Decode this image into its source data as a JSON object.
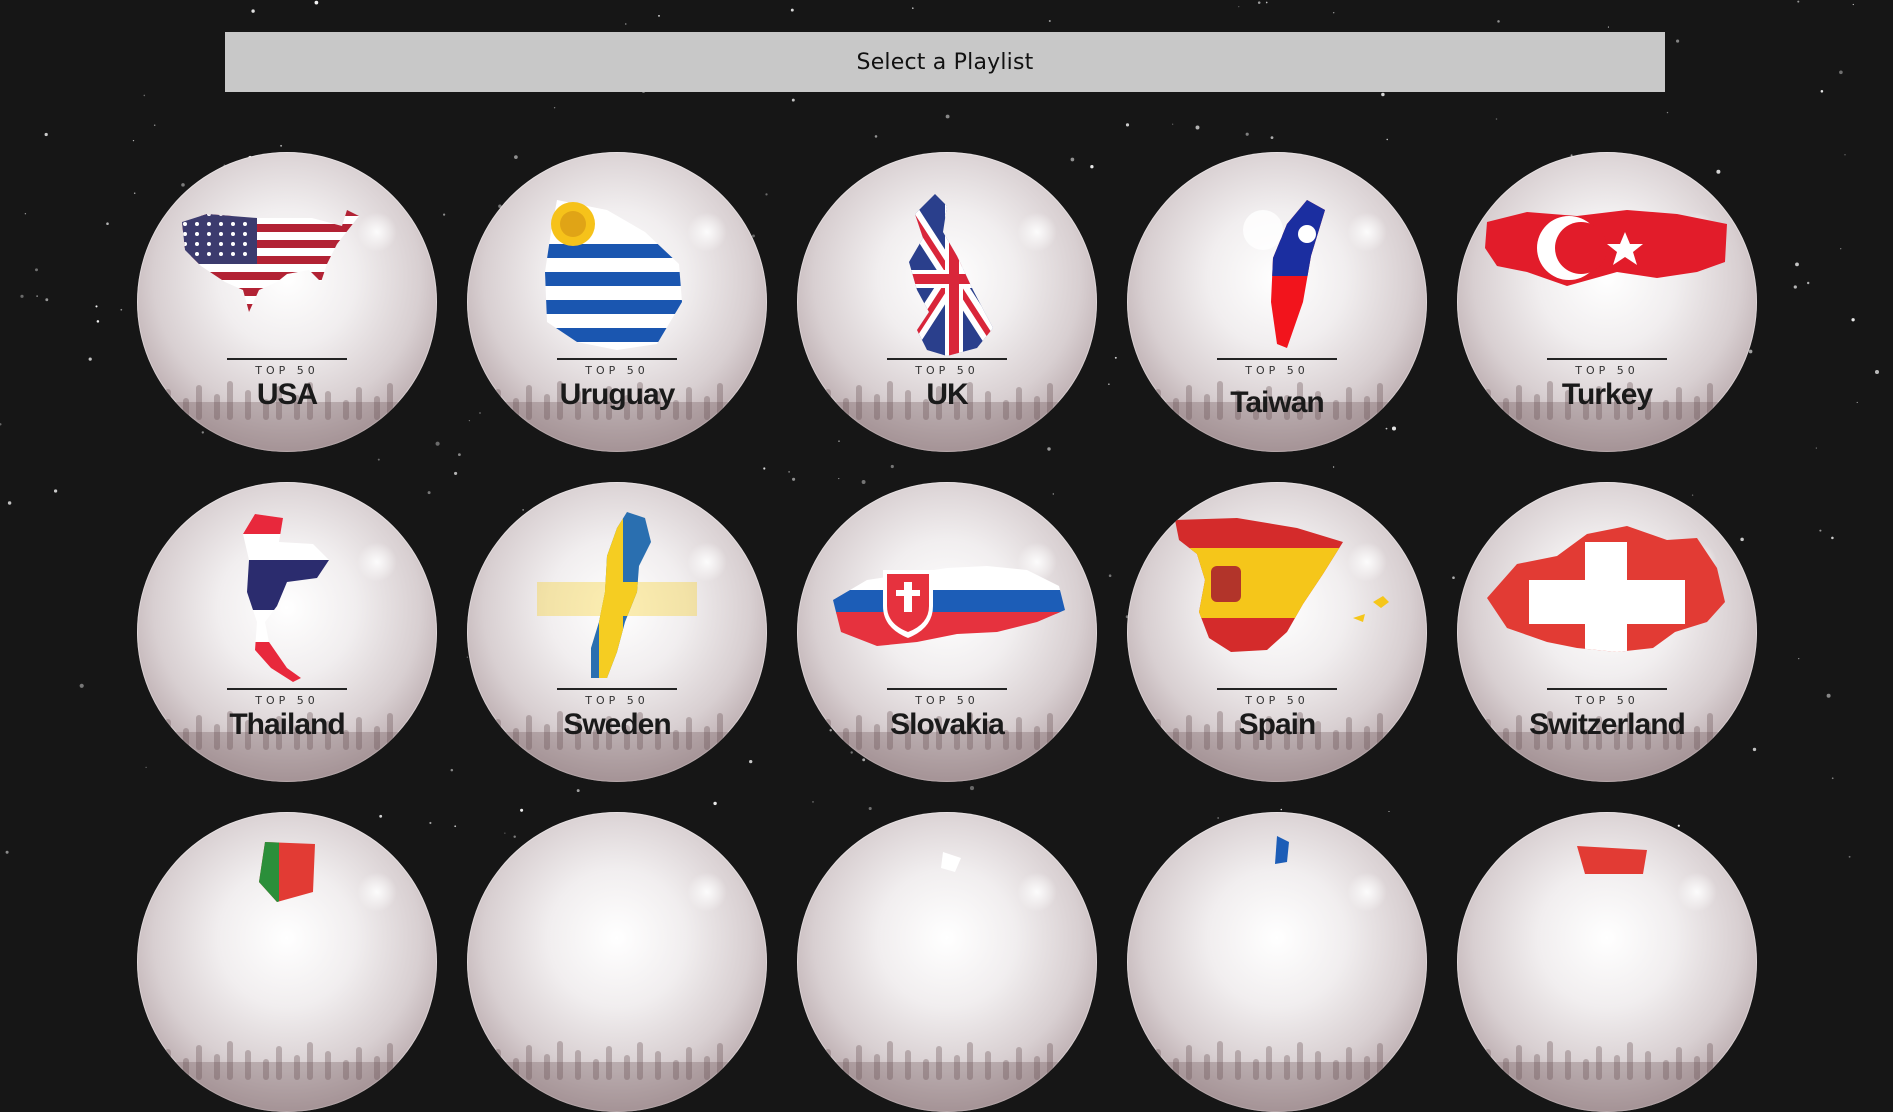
{
  "header": {
    "label": "Select a Playlist"
  },
  "playlist_tag": "TOP 50",
  "playlists": [
    {
      "name": "USA",
      "flag": "usa-map-flag",
      "colors": [
        "#b22234",
        "#ffffff",
        "#3c3b6e"
      ]
    },
    {
      "name": "Uruguay",
      "flag": "uruguay-map-flag",
      "colors": [
        "#1a56b0",
        "#ffffff",
        "#f6c21a"
      ]
    },
    {
      "name": "UK",
      "flag": "uk-map-flag",
      "colors": [
        "#2a3f8c",
        "#ffffff",
        "#d9263a"
      ]
    },
    {
      "name": "Taiwan",
      "flag": "taiwan-map-flag",
      "colors": [
        "#1b2ea0",
        "#ffffff",
        "#f2141c"
      ]
    },
    {
      "name": "Turkey",
      "flag": "turkey-map-flag",
      "colors": [
        "#e21c2a",
        "#ffffff"
      ]
    },
    {
      "name": "Thailand",
      "flag": "thailand-map-flag",
      "colors": [
        "#e8283c",
        "#ffffff",
        "#2b2c6e"
      ]
    },
    {
      "name": "Sweden",
      "flag": "sweden-map-flag",
      "colors": [
        "#2a6fb0",
        "#f5cd22"
      ]
    },
    {
      "name": "Slovakia",
      "flag": "slovakia-map-flag",
      "colors": [
        "#ffffff",
        "#1c5db7",
        "#e6323e"
      ]
    },
    {
      "name": "Spain",
      "flag": "spain-map-flag",
      "colors": [
        "#d42b2b",
        "#f5c61a"
      ]
    },
    {
      "name": "Switzerland",
      "flag": "switzerland-map-flag",
      "colors": [
        "#e23b34",
        "#ffffff"
      ]
    },
    {
      "name": "",
      "flag": "portugal-map-flag",
      "colors": [
        "#2b8f3a",
        "#e23b34"
      ]
    },
    {
      "name": "",
      "flag": "unknown-map-flag",
      "colors": []
    },
    {
      "name": "",
      "flag": "unknown-map-flag",
      "colors": [
        "#ffffff"
      ]
    },
    {
      "name": "",
      "flag": "unknown-map-flag",
      "colors": [
        "#1c5db7"
      ]
    },
    {
      "name": "",
      "flag": "unknown-map-flag",
      "colors": [
        "#e23b34"
      ]
    }
  ]
}
